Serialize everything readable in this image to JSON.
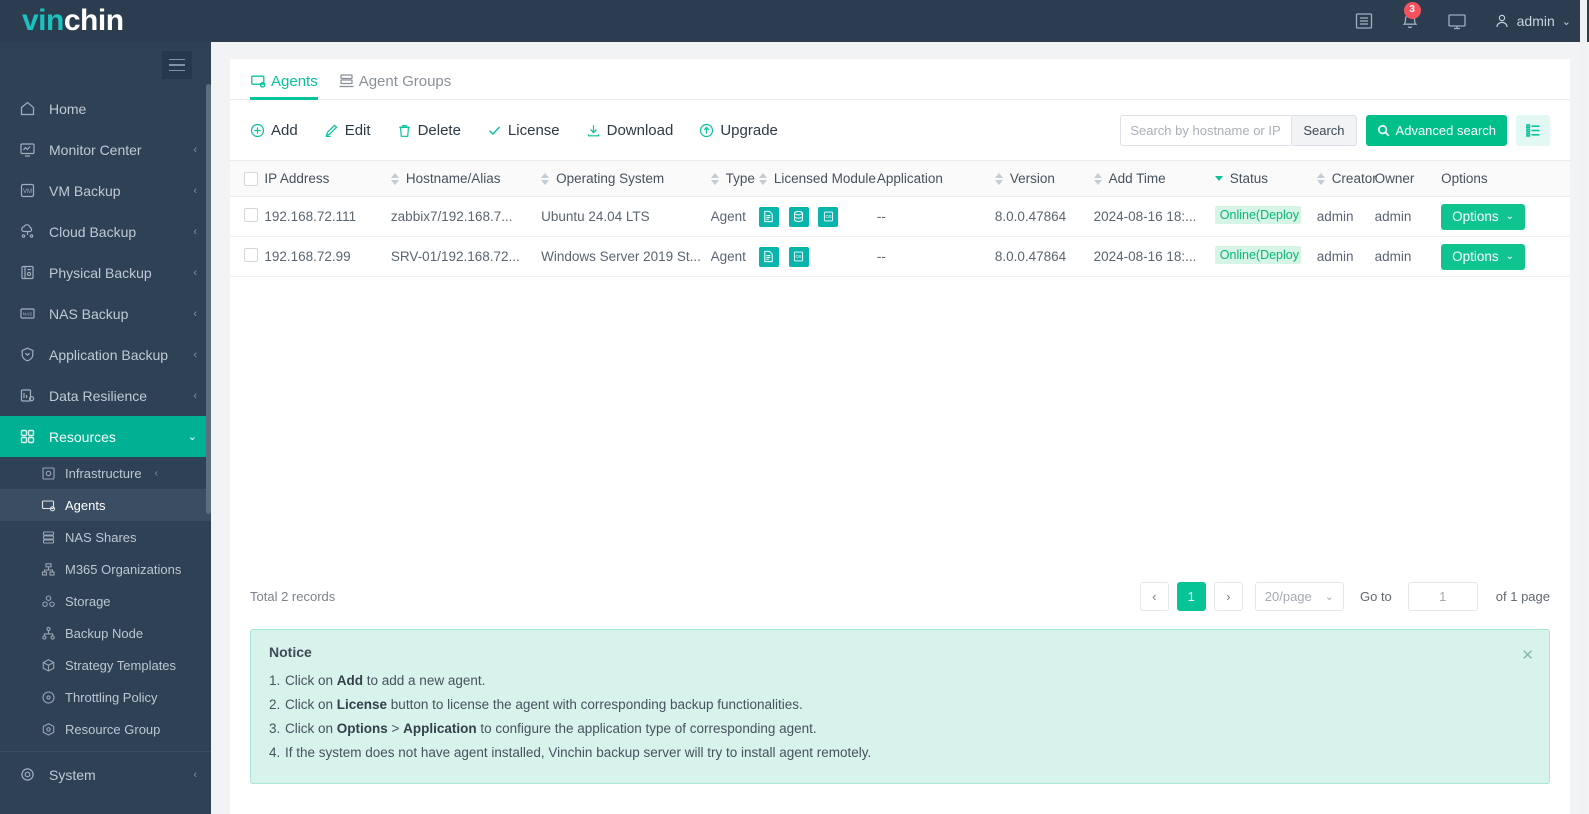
{
  "brand": {
    "part1": "vin",
    "part2": "chin"
  },
  "topbar": {
    "log_icon": "list-log-icon",
    "notification_icon": "bell-icon",
    "notification_count": "3",
    "display_icon": "monitor-icon",
    "user_icon": "user-avatar-icon",
    "username": "admin",
    "user_chevron": "⌄"
  },
  "sidebar": {
    "collapse_icon": "hamburger-icon",
    "items": [
      {
        "label": "Home",
        "icon": "home-icon",
        "chevron": "",
        "active": false
      },
      {
        "label": "Monitor Center",
        "icon": "monitor-chart-icon",
        "chevron": "‹",
        "active": false
      },
      {
        "label": "VM Backup",
        "icon": "vm-icon",
        "chevron": "‹",
        "active": false
      },
      {
        "label": "Cloud Backup",
        "icon": "cloud-icon",
        "chevron": "‹",
        "active": false
      },
      {
        "label": "Physical Backup",
        "icon": "server-icon",
        "chevron": "‹",
        "active": false
      },
      {
        "label": "NAS Backup",
        "icon": "nas-icon",
        "chevron": "‹",
        "active": false
      },
      {
        "label": "Application Backup",
        "icon": "shield-icon",
        "chevron": "‹",
        "active": false
      },
      {
        "label": "Data Resilience",
        "icon": "resilience-icon",
        "chevron": "‹",
        "active": false
      },
      {
        "label": "Resources",
        "icon": "resources-grid-icon",
        "chevron": "⌄",
        "active": true
      }
    ],
    "sub_items": [
      {
        "label": "Infrastructure",
        "icon": "infrastructure-icon",
        "chevron": "‹",
        "selected": false
      },
      {
        "label": "Agents",
        "icon": "agents-icon",
        "chevron": "",
        "selected": true
      },
      {
        "label": "NAS Shares",
        "icon": "nas-shares-icon",
        "chevron": "",
        "selected": false
      },
      {
        "label": "M365 Organizations",
        "icon": "org-tree-icon",
        "chevron": "",
        "selected": false
      },
      {
        "label": "Storage",
        "icon": "storage-icon",
        "chevron": "",
        "selected": false
      },
      {
        "label": "Backup Node",
        "icon": "node-tree-icon",
        "chevron": "",
        "selected": false
      },
      {
        "label": "Strategy Templates",
        "icon": "cube-icon",
        "chevron": "",
        "selected": false
      },
      {
        "label": "Throttling Policy",
        "icon": "throttle-icon",
        "chevron": "",
        "selected": false
      },
      {
        "label": "Resource Group",
        "icon": "resource-group-icon",
        "chevron": "",
        "selected": false
      }
    ],
    "footer_items": [
      {
        "label": "System",
        "icon": "gear-icon",
        "chevron": "‹"
      }
    ]
  },
  "tabs": [
    {
      "label": "Agents",
      "icon": "agents-tab-icon",
      "active": true
    },
    {
      "label": "Agent Groups",
      "icon": "agent-groups-tab-icon",
      "active": false
    }
  ],
  "toolbar": {
    "buttons": [
      {
        "label": "Add",
        "icon": "plus-circle-icon"
      },
      {
        "label": "Edit",
        "icon": "pencil-icon"
      },
      {
        "label": "Delete",
        "icon": "trash-icon"
      },
      {
        "label": "License",
        "icon": "check-icon"
      },
      {
        "label": "Download",
        "icon": "download-icon"
      },
      {
        "label": "Upgrade",
        "icon": "upload-circle-icon"
      }
    ],
    "search_placeholder": "Search by hostname or IP",
    "search_value": "",
    "search_button": "Search",
    "advanced_search": "Advanced search",
    "advanced_search_icon": "magnifier-icon",
    "column_settings_icon": "column-list-icon"
  },
  "table": {
    "columns": [
      {
        "label": "IP Address",
        "sortable": true,
        "sort": "none"
      },
      {
        "label": "Hostname/Alias",
        "sortable": true,
        "sort": "none"
      },
      {
        "label": "Operating System",
        "sortable": true,
        "sort": "none"
      },
      {
        "label": "Type",
        "sortable": true,
        "sort": "none"
      },
      {
        "label": "Licensed Module",
        "sortable": false,
        "sort": "none"
      },
      {
        "label": "Application",
        "sortable": true,
        "sort": "none"
      },
      {
        "label": "Version",
        "sortable": true,
        "sort": "none"
      },
      {
        "label": "Add Time",
        "sortable": true,
        "sort": "desc"
      },
      {
        "label": "Status",
        "sortable": true,
        "sort": "none"
      },
      {
        "label": "Creator",
        "sortable": false,
        "sort": "none"
      },
      {
        "label": "Owner",
        "sortable": false,
        "sort": "none"
      },
      {
        "label": "Options",
        "sortable": false,
        "sort": "none"
      }
    ],
    "rows": [
      {
        "ip": "192.168.72.111",
        "hostname": "zabbix7/192.168.7...",
        "os": "Ubuntu 24.04 LTS",
        "type": "Agent",
        "modules": [
          "file-module-icon",
          "database-module-icon",
          "os-module-icon"
        ],
        "application": "--",
        "version": "8.0.0.47864",
        "add_time": "2024-08-16 18:...",
        "status": "Online(Deploy",
        "creator": "admin",
        "owner": "admin",
        "options_label": "Options"
      },
      {
        "ip": "192.168.72.99",
        "hostname": "SRV-01/192.168.72...",
        "os": "Windows Server 2019 St...",
        "type": "Agent",
        "modules": [
          "file-module-icon",
          "os-module-icon"
        ],
        "application": "--",
        "version": "8.0.0.47864",
        "add_time": "2024-08-16 18:...",
        "status": "Online(Deploy",
        "creator": "admin",
        "owner": "admin",
        "options_label": "Options"
      }
    ]
  },
  "footer": {
    "total": "Total 2 records",
    "prev": "‹",
    "page_current": "1",
    "next": "›",
    "page_size": "20/page",
    "page_size_chevron": "⌄",
    "goto_label": "Go to",
    "goto_value": "1",
    "of_pages": "of 1 page"
  },
  "notice": {
    "title": "Notice",
    "close_icon": "close-icon",
    "items": [
      {
        "pre": "Click on ",
        "b1": "Add",
        "mid": " to add a new agent.",
        "b2": "",
        "post": ""
      },
      {
        "pre": "Click on ",
        "b1": "License",
        "mid": " button to license the agent with corresponding backup functionalities.",
        "b2": "",
        "post": ""
      },
      {
        "pre": "Click on ",
        "b1": "Options",
        "mid": " > ",
        "b2": "Application",
        "post": " to configure the application type of corresponding agent."
      },
      {
        "pre": "If the system does not have agent installed, Vinchin backup server will try to install agent remotely.",
        "b1": "",
        "mid": "",
        "b2": "",
        "post": ""
      }
    ]
  },
  "colors": {
    "brand_teal": "#19c3c0",
    "accent_green": "#00b093",
    "button_green": "#0fc48e",
    "sidebar_bg": "#2f4155",
    "topbar_bg": "#2b3d4f",
    "notice_bg": "#d8f3ec",
    "badge_red": "#f5525f"
  }
}
